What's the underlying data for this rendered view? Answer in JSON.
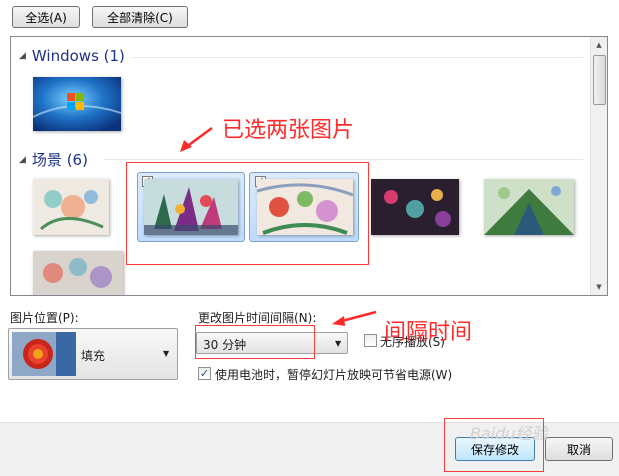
{
  "toolbar": {
    "select_all_label": "全选(A)",
    "clear_all_label": "全部清除(C)"
  },
  "gallery": {
    "groups": [
      {
        "title": "Windows (1)"
      },
      {
        "title": "场景 (6)"
      }
    ]
  },
  "picture_position": {
    "label": "图片位置(P):",
    "selected_value": "填充"
  },
  "interval": {
    "label": "更改图片时间间隔(N):",
    "selected_value": "30 分钟"
  },
  "shuffle": {
    "label": "无序播放(S)",
    "checked": false
  },
  "battery": {
    "label": "使用电池时，暂停幻灯片放映可节省电源(W)",
    "checked": true
  },
  "footer": {
    "save_label": "保存修改",
    "cancel_label": "取消"
  },
  "annotations": {
    "selected_note": "已选两张图片",
    "interval_note": "间隔时间"
  },
  "watermark": "Baidu经验",
  "colors": {
    "accent": "#1e3287",
    "annotation": "#ff2a2a"
  }
}
